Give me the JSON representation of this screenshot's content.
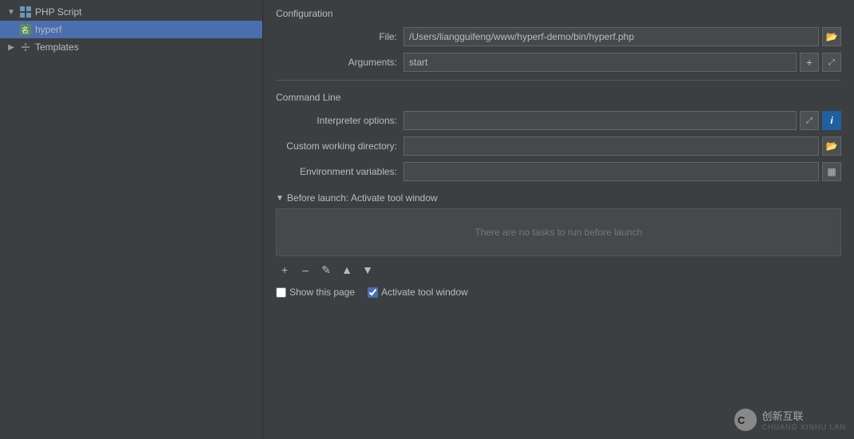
{
  "left_panel": {
    "items": [
      {
        "id": "php-script",
        "label": "PHP Script",
        "level": 0,
        "expanded": true,
        "selected": false,
        "has_arrow": true,
        "arrow_down": true
      },
      {
        "id": "hyperf",
        "label": "hyperf",
        "level": 1,
        "expanded": false,
        "selected": true,
        "has_arrow": false,
        "arrow_down": false
      },
      {
        "id": "templates",
        "label": "Templates",
        "level": 0,
        "expanded": false,
        "selected": false,
        "has_arrow": true,
        "arrow_down": false
      }
    ]
  },
  "right_panel": {
    "configuration_title": "Configuration",
    "file_label": "File:",
    "file_value": "/Users/liangguifeng/www/hyperf-demo/bin/hyperf.php",
    "arguments_label": "Arguments:",
    "arguments_value": "start",
    "command_line_title": "Command Line",
    "interpreter_options_label": "Interpreter options:",
    "interpreter_options_value": "",
    "custom_working_directory_label": "Custom working directory:",
    "custom_working_directory_value": "",
    "environment_variables_label": "Environment variables:",
    "environment_variables_value": "",
    "before_launch_title": "Before launch: Activate tool window",
    "no_tasks_text": "There are no tasks to run before launch",
    "show_page_label": "Show this page",
    "activate_tool_window_label": "Activate tool window",
    "show_page_checked": false,
    "activate_tool_window_checked": true
  },
  "watermark": {
    "text": "创新互联",
    "sub_text": "CHUANG XINHU LAN"
  },
  "icons": {
    "folder": "📁",
    "expand_more": "▼",
    "expand_right": "▶",
    "add": "+",
    "minus": "–",
    "edit": "✎",
    "up": "▲",
    "down": "▼",
    "info": "i",
    "collapse_down": "▼"
  }
}
